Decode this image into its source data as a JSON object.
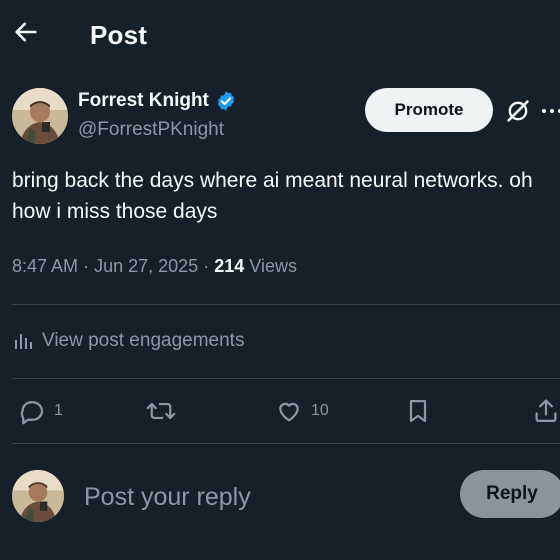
{
  "header": {
    "title": "Post",
    "back_icon": "arrow-left-icon"
  },
  "author": {
    "name": "Forrest Knight",
    "handle": "@ForrestPKnight",
    "verified": true,
    "verified_color": "#1d9bf0"
  },
  "actions_top": {
    "promote_label": "Promote",
    "grok_icon": "grok-icon",
    "more_icon": "more-icon"
  },
  "post": {
    "text": "bring back the days where ai meant neural networks. oh how i miss those days",
    "time": "8:47 AM",
    "separator": "·",
    "date": "Jun 27, 2025",
    "views_count": "214",
    "views_label": "Views"
  },
  "engagements": {
    "label": "View post engagements",
    "icon": "analytics-icon"
  },
  "action_bar": {
    "reply_count": "1",
    "repost_count": "",
    "like_count": "10",
    "icons": [
      "reply-icon",
      "repost-icon",
      "like-icon",
      "bookmark-icon",
      "share-icon"
    ]
  },
  "reply": {
    "placeholder": "Post your reply",
    "button_label": "Reply"
  },
  "colors": {
    "background": "#15202b",
    "muted": "#8b98a5",
    "divider": "#38444d",
    "accent": "#1d9bf0"
  }
}
